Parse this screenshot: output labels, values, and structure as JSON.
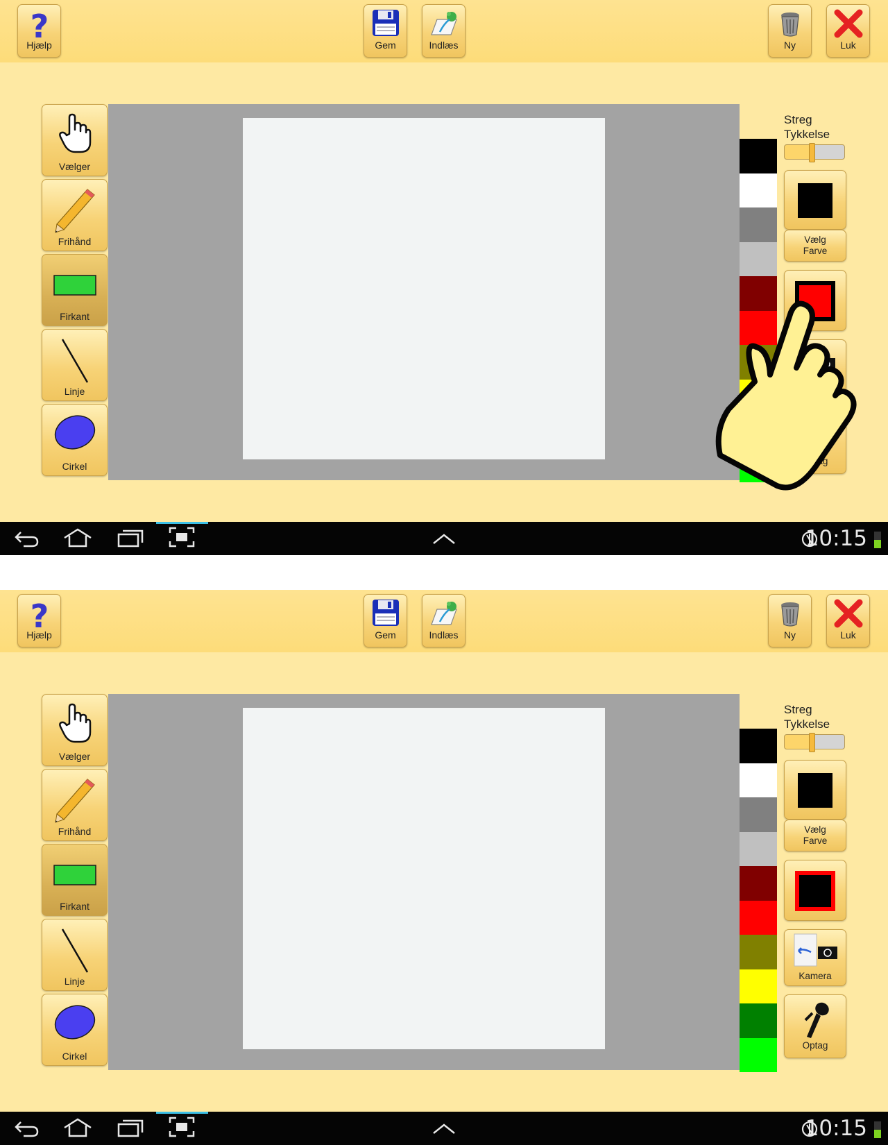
{
  "top": {
    "help_label": "Hjælp",
    "save_label": "Gem",
    "load_label": "Indlæs",
    "new_label": "Ny",
    "close_label": "Luk"
  },
  "tools": {
    "selector_label": "Vælger",
    "freehand_label": "Frihånd",
    "rectangle_label": "Firkant",
    "line_label": "Linje",
    "circle_label": "Cirkel",
    "active_tool": "Firkant"
  },
  "sidebar": {
    "stroke_title_line1": "Streg",
    "stroke_title_line2": "Tykkelse",
    "stroke_thickness_fraction": 0.45,
    "choose_color_line1": "Vælg",
    "choose_color_line2": "Farve",
    "camera_label": "Kamera",
    "record_label": "Optag"
  },
  "palette": [
    "#000000",
    "#ffffff",
    "#808080",
    "#c0c0c0",
    "#800000",
    "#ff0000",
    "#808000",
    "#ffff00",
    "#008000",
    "#00ff00"
  ],
  "colors": {
    "fill_top": "#ff0000",
    "fill_bottom": "#000000",
    "outline_top": "#000000",
    "outline_bottom": "#ff0000"
  },
  "system": {
    "clock": "10:15"
  }
}
